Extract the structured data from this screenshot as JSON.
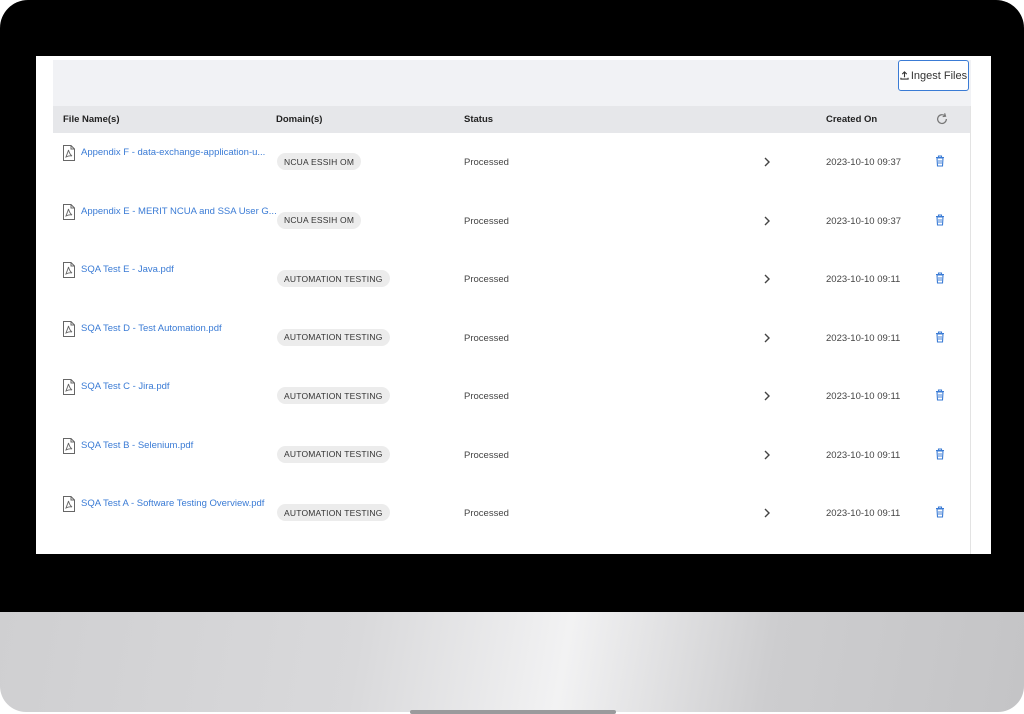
{
  "toolbar": {
    "ingest_label": "Ingest Files"
  },
  "table": {
    "headers": {
      "file_name": "File Name(s)",
      "domain": "Domain(s)",
      "status": "Status",
      "created_on": "Created On"
    },
    "rows": [
      {
        "file": "Appendix F - data-exchange-application-u...",
        "domain": "NCUA ESSIH OM",
        "status": "Processed",
        "created": "2023-10-10 09:37"
      },
      {
        "file": "Appendix E - MERIT NCUA and SSA User G...",
        "domain": "NCUA ESSIH OM",
        "status": "Processed",
        "created": "2023-10-10 09:37"
      },
      {
        "file": "SQA Test E - Java.pdf",
        "domain": "AUTOMATION TESTING",
        "status": "Processed",
        "created": "2023-10-10 09:11"
      },
      {
        "file": "SQA Test D - Test Automation.pdf",
        "domain": "AUTOMATION TESTING",
        "status": "Processed",
        "created": "2023-10-10 09:11"
      },
      {
        "file": "SQA Test C - Jira.pdf",
        "domain": "AUTOMATION TESTING",
        "status": "Processed",
        "created": "2023-10-10 09:11"
      },
      {
        "file": "SQA Test B - Selenium.pdf",
        "domain": "AUTOMATION TESTING",
        "status": "Processed",
        "created": "2023-10-10 09:11"
      },
      {
        "file": "SQA Test A - Software Testing Overview.pdf",
        "domain": "AUTOMATION TESTING",
        "status": "Processed",
        "created": "2023-10-10 09:11"
      }
    ]
  },
  "icons": {
    "upload": "upload-icon",
    "refresh": "refresh-icon",
    "file": "pdf-file-icon",
    "expand": "chevron-right-icon",
    "delete": "trash-icon"
  },
  "colors": {
    "link": "#3a7bd5",
    "header_bg": "#e6e7ea",
    "chip_bg": "#ececec",
    "accent_border": "#3a7bd5"
  }
}
